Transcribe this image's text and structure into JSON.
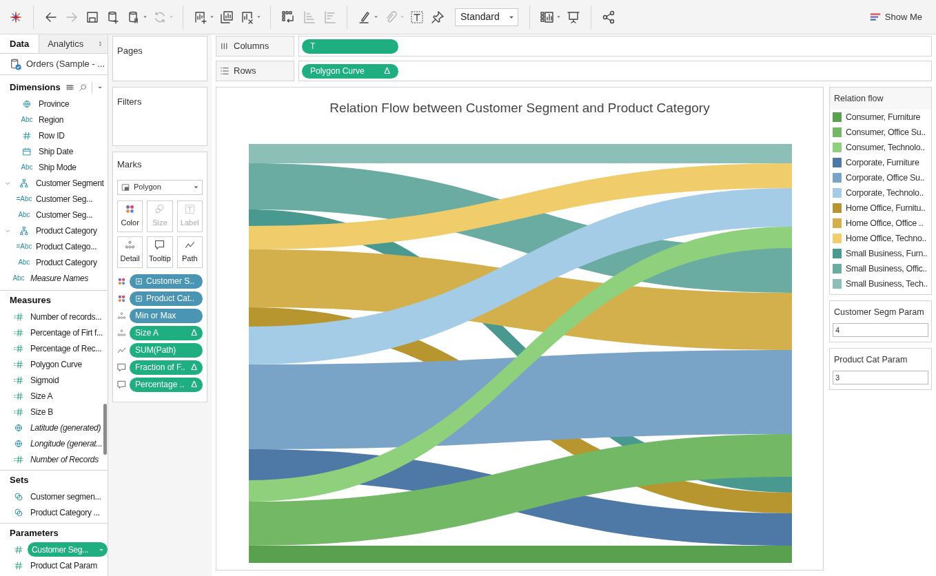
{
  "toolbar": [
    {
      "kind": "logo"
    },
    {
      "kind": "sep"
    },
    {
      "kind": "back",
      "disabled": false
    },
    {
      "kind": "forward",
      "disabled": true
    },
    {
      "kind": "save",
      "disabled": false
    },
    {
      "kind": "add-datasource",
      "disabled": false
    },
    {
      "kind": "pause",
      "disabled": false
    },
    {
      "kind": "caret",
      "disabled": false
    },
    {
      "kind": "refresh",
      "disabled": true
    },
    {
      "kind": "caret",
      "disabled": true
    },
    {
      "kind": "sep"
    },
    {
      "kind": "new-sheet",
      "disabled": false
    },
    {
      "kind": "caret",
      "disabled": false
    },
    {
      "kind": "duplicate",
      "disabled": false
    },
    {
      "kind": "clear",
      "disabled": false
    },
    {
      "kind": "caret",
      "disabled": false
    },
    {
      "kind": "sep"
    },
    {
      "kind": "swap",
      "disabled": false
    },
    {
      "kind": "sort-ascending",
      "disabled": true
    },
    {
      "kind": "sort-descending",
      "disabled": true
    },
    {
      "kind": "sep"
    },
    {
      "kind": "highlight",
      "disabled": false
    },
    {
      "kind": "caret",
      "disabled": false
    },
    {
      "kind": "attach",
      "disabled": true
    },
    {
      "kind": "caret",
      "disabled": true
    },
    {
      "kind": "text-box",
      "disabled": false
    },
    {
      "kind": "pin",
      "disabled": false
    },
    {
      "kind": "fit",
      "label": "Standard"
    },
    {
      "kind": "sep"
    },
    {
      "kind": "cards",
      "disabled": false
    },
    {
      "kind": "caret",
      "disabled": false
    },
    {
      "kind": "presentation",
      "disabled": false
    },
    {
      "kind": "sep"
    },
    {
      "kind": "share",
      "disabled": false
    }
  ],
  "show_me": "Show Me",
  "data_pane": {
    "tabs": [
      {
        "label": "Data",
        "selected": true
      },
      {
        "label": "Analytics",
        "selected": false
      }
    ],
    "datasource": "Orders (Sample - ...",
    "sections": [
      {
        "title": "Dimensions",
        "items": [
          {
            "kind": "geo",
            "label": "Province"
          },
          {
            "kind": "string",
            "type_text": "Abc",
            "label": "Region"
          },
          {
            "kind": "number",
            "label": "Row ID"
          },
          {
            "kind": "date",
            "label": "Ship Date"
          },
          {
            "kind": "string",
            "type_text": "Abc",
            "label": "Ship Mode"
          },
          {
            "kind": "hierarchy",
            "label": "Customer Segment",
            "expanded": true,
            "children": [
              {
                "kind": "string",
                "type_text": "=Abc",
                "label": "Customer Seg..."
              },
              {
                "kind": "string",
                "type_text": "Abc",
                "label": "Customer Seg..."
              }
            ]
          },
          {
            "kind": "hierarchy",
            "label": "Product Category",
            "expanded": true,
            "children": [
              {
                "kind": "string",
                "type_text": "=Abc",
                "label": "Product Catego..."
              },
              {
                "kind": "string",
                "type_text": "Abc",
                "label": "Product Category"
              }
            ]
          },
          {
            "kind": "string",
            "type_text": "Abc",
            "label": "Measure Names",
            "generated": true
          }
        ]
      },
      {
        "title": "Measures",
        "items": [
          {
            "kind": "calc",
            "label": "Number of records..."
          },
          {
            "kind": "calc",
            "label": "Percentage of Firt f..."
          },
          {
            "kind": "calc",
            "label": "Percentage of Rec..."
          },
          {
            "kind": "calc",
            "label": "Polygon Curve"
          },
          {
            "kind": "calc",
            "label": "Sigmoid"
          },
          {
            "kind": "calc",
            "label": "Size A"
          },
          {
            "kind": "calc",
            "label": "Size B"
          },
          {
            "kind": "geo",
            "label": "Latitude (generated)",
            "generated": true
          },
          {
            "kind": "geo",
            "label": "Longitude (generat...",
            "generated": true
          },
          {
            "kind": "calc",
            "label": "Number of Records",
            "generated": true
          }
        ]
      },
      {
        "title": "Sets",
        "items": [
          {
            "kind": "set",
            "label": "Customer segmen..."
          },
          {
            "kind": "set",
            "label": "Product Category ..."
          }
        ]
      },
      {
        "title": "Parameters",
        "items": [
          {
            "kind": "param",
            "label": "Customer Seg...",
            "selected": true
          },
          {
            "kind": "param",
            "label": "Product Cat Param",
            "selected": false
          }
        ]
      }
    ]
  },
  "pages": "Pages",
  "filters": "Filters",
  "columns": {
    "label": "Columns",
    "pills": [
      {
        "label": "T"
      }
    ]
  },
  "rows": {
    "label": "Rows",
    "pills": [
      {
        "label": "Polygon Curve",
        "badge": "Δ"
      }
    ]
  },
  "marks": {
    "title": "Marks",
    "mark_type": "Polygon",
    "cards": [
      {
        "kind": "color",
        "label": "Color",
        "disabled": false
      },
      {
        "kind": "size",
        "label": "Size",
        "disabled": true
      },
      {
        "kind": "label",
        "label": "Label",
        "disabled": true
      },
      {
        "kind": "detail",
        "label": "Detail",
        "disabled": false
      },
      {
        "kind": "tooltip",
        "label": "Tooltip",
        "disabled": false
      },
      {
        "kind": "path",
        "label": "Path",
        "disabled": false
      }
    ],
    "pills": [
      {
        "kind": "color",
        "label": "Customer S..",
        "dimension": true,
        "set": true
      },
      {
        "kind": "color",
        "label": "Product Cat..",
        "dimension": true,
        "set": true
      },
      {
        "kind": "detail",
        "label": "Min or Max",
        "dimension": true,
        "set": false
      },
      {
        "kind": "detail",
        "label": "Size A",
        "dimension": false,
        "set": false,
        "badge": "Δ"
      },
      {
        "kind": "path",
        "label": "SUM(Path)",
        "dimension": false,
        "set": false
      },
      {
        "kind": "tooltip",
        "label": "Fraction of F..",
        "dimension": false,
        "set": false,
        "badge": "Δ"
      },
      {
        "kind": "tooltip",
        "label": "Percentage ..",
        "dimension": false,
        "set": false,
        "badge": "Δ"
      }
    ]
  },
  "view": {
    "title": "Relation Flow between Customer Segment and Product Category"
  },
  "legend": {
    "title": "Relation flow",
    "items": [
      {
        "label": "Consumer, Furniture",
        "color": "#59a14f"
      },
      {
        "label": "Consumer, Office Su..",
        "color": "#72b865"
      },
      {
        "label": "Consumer, Technolo..",
        "color": "#8fd07c"
      },
      {
        "label": "Corporate, Furniture",
        "color": "#4e79a7"
      },
      {
        "label": "Corporate, Office Su..",
        "color": "#79a3c7"
      },
      {
        "label": "Corporate, Technolo..",
        "color": "#a5cce6"
      },
      {
        "label": "Home Office, Furnitu..",
        "color": "#b8962f"
      },
      {
        "label": "Home Office, Office ..",
        "color": "#d4b04d"
      },
      {
        "label": "Home Office, Techno..",
        "color": "#f0cd6a"
      },
      {
        "label": "Small Business, Furn..",
        "color": "#4a9990"
      },
      {
        "label": "Small Business, Offic..",
        "color": "#6aaba2"
      },
      {
        "label": "Small Business, Tech..",
        "color": "#8bbfb7"
      }
    ]
  },
  "parameters": [
    {
      "title": "Customer Segm Param",
      "value": "4"
    },
    {
      "title": "Product Cat Param",
      "value": "3"
    }
  ]
}
